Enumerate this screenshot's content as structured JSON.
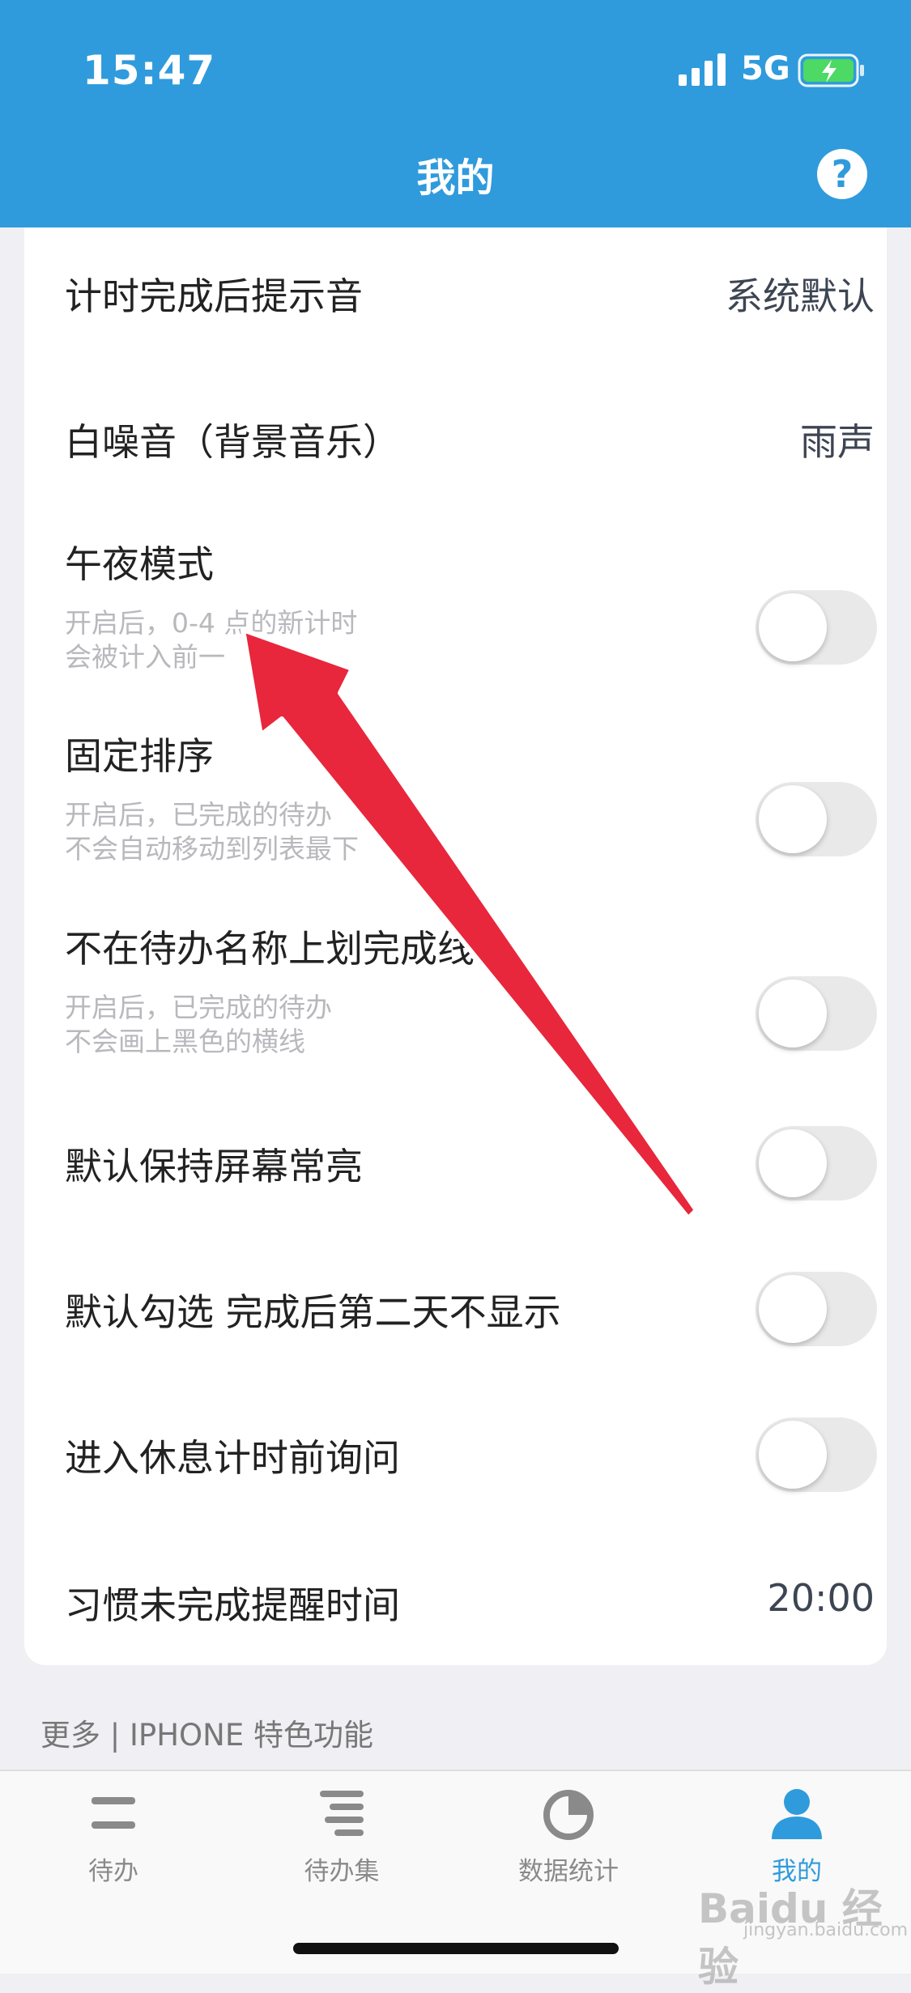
{
  "status_bar": {
    "time": "15:47",
    "network": "5G"
  },
  "header": {
    "title": "我的"
  },
  "settings": {
    "sound": {
      "label": "计时完成后提示音",
      "value": "系统默认"
    },
    "white_noise": {
      "label": "白噪音（背景音乐）",
      "value": "雨声"
    },
    "midnight": {
      "label": "午夜模式",
      "desc_line1": "开启后，0-4 点的新计时",
      "desc_line2": "会被计入前一",
      "on": false
    },
    "fixed_sort": {
      "label": "固定排序",
      "desc_line1": "开启后，已完成的待办",
      "desc_line2": "不会自动移动到列表最下",
      "on": false
    },
    "no_strike": {
      "label": "不在待办名称上划完成线",
      "desc_line1": "开启后，已完成的待办",
      "desc_line2": "不会画上黑色的横线",
      "on": false
    },
    "screen_on": {
      "label": "默认保持屏幕常亮",
      "on": false
    },
    "hide_next_day": {
      "label": "默认勾选 完成后第二天不显示",
      "on": false
    },
    "ask_rest": {
      "label": "进入休息计时前询问",
      "on": false
    },
    "habit_reminder": {
      "label": "习惯未完成提醒时间",
      "value": "20:00"
    }
  },
  "more_section": {
    "label": "更多 | IPHONE 特色功能"
  },
  "tabbar": {
    "items": [
      {
        "label": "待办",
        "icon": "list-icon"
      },
      {
        "label": "待办集",
        "icon": "stack-list-icon"
      },
      {
        "label": "数据统计",
        "icon": "pie-chart-icon"
      },
      {
        "label": "我的",
        "icon": "person-icon"
      }
    ],
    "active_color": "#2f9bdc"
  },
  "watermark": {
    "text": "Baidu 经验",
    "sub": "jingyan.baidu.com"
  },
  "colors": {
    "header": "#2f9bdc",
    "arrow": "#e8263c"
  }
}
